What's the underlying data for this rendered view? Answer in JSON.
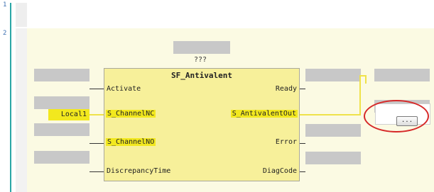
{
  "line_numbers": [
    "1",
    "2"
  ],
  "instance_name": "???",
  "function_block": {
    "type_name": "SF_Antivalent",
    "inputs": [
      "Activate",
      "S_ChannelNC",
      "S_ChannelNO",
      "DiscrepancyTime"
    ],
    "outputs": [
      "Ready",
      "S_AntivalentOut",
      "Error",
      "DiagCode"
    ]
  },
  "input_variable": "Local1",
  "more_button_label": "...",
  "colors": {
    "highlight": "#f2e81e",
    "network_bg": "#fbfae3",
    "annotation": "#d62828"
  }
}
